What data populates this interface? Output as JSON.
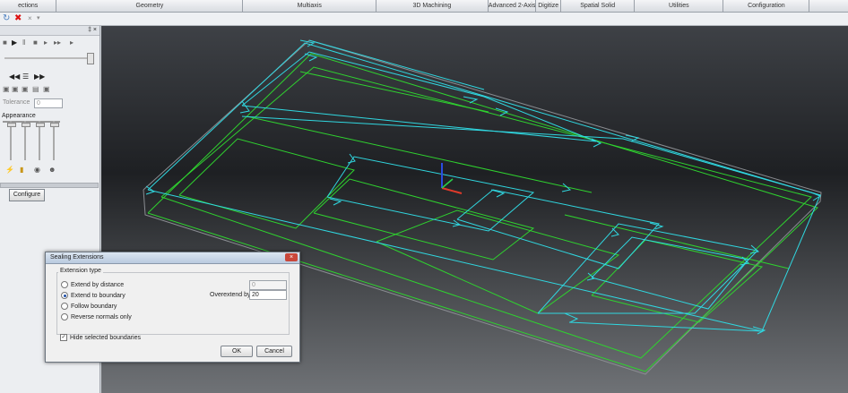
{
  "menu_tabs": [
    "ections",
    "Geometry",
    "Multiaxis",
    "3D Machining",
    "Advanced 2-Axis",
    "Digitize",
    "Spatial Solid",
    "Utilities",
    "Configuration"
  ],
  "left_panel": {
    "pin_label": "‡ ×",
    "tolerance_label": "Tolerance",
    "tolerance_value": "0",
    "appearance_label": "Appearance",
    "configure_label": "Configure"
  },
  "dialog": {
    "title": "Sealing Extensions",
    "group_label": "Extension type",
    "options": [
      "Extend by distance",
      "Extend to boundary",
      "Follow boundary",
      "Reverse normals only"
    ],
    "selected_index": 1,
    "distance_value": "0",
    "overextend_label": "Overextend by",
    "overextend_value": "20",
    "checkbox_label": "Hide selected boundaries",
    "checkbox_checked": true,
    "ok_label": "OK",
    "cancel_label": "Cancel",
    "close_glyph": "×"
  },
  "colors": {
    "cyan": "#30d7e0",
    "green": "#2fd22f",
    "axis_z": "#2a4de0",
    "axis_x": "#e03a2a",
    "axis_y": "#2ad24a"
  }
}
